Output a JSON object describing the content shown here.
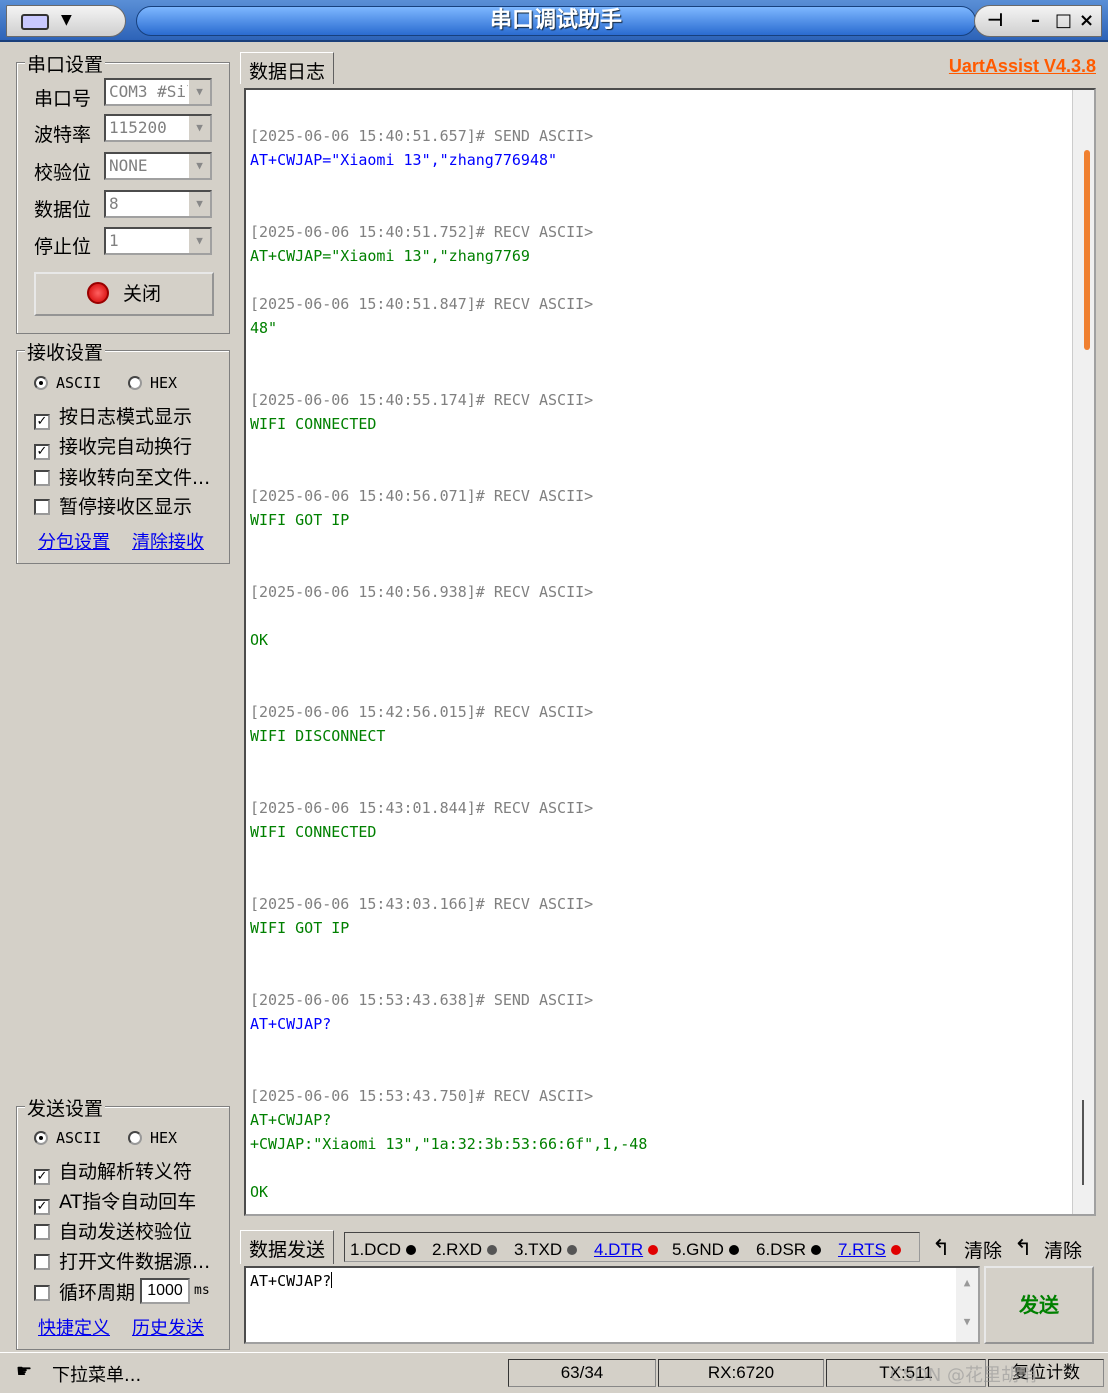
{
  "window": {
    "title": "串口调试助手",
    "brand": "UartAssist V4.3.8"
  },
  "serial": {
    "group_title": "串口设置",
    "port_label": "串口号",
    "port_value": "COM3 #Sil",
    "baud_label": "波特率",
    "baud_value": "115200",
    "parity_label": "校验位",
    "parity_value": "NONE",
    "databits_label": "数据位",
    "databits_value": "8",
    "stopbits_label": "停止位",
    "stopbits_value": "1",
    "close_button": "关闭"
  },
  "receive": {
    "group_title": "接收设置",
    "ascii": "ASCII",
    "hex": "HEX",
    "opt_log_mode": "按日志模式显示",
    "opt_auto_newline": "接收完自动换行",
    "opt_to_file": "接收转向至文件...",
    "opt_pause": "暂停接收区显示",
    "link_packet": "分包设置",
    "link_clear": "清除接收"
  },
  "send_settings": {
    "group_title": "发送设置",
    "ascii": "ASCII",
    "hex": "HEX",
    "opt_escape": "自动解析转义符",
    "opt_at_cr": "AT指令自动回车",
    "opt_checksum": "自动发送校验位",
    "opt_file_src": "打开文件数据源...",
    "opt_loop": "循环周期",
    "loop_value": "1000",
    "loop_unit": "ms",
    "link_shortcut": "快捷定义",
    "link_history": "历史发送"
  },
  "log": {
    "tab": "数据日志",
    "entries": [
      {
        "ts": "[2025-06-06 15:40:51.657]# SEND ASCII>",
        "lines": [
          "AT+CWJAP=\"Xiaomi 13\",\"zhang776948\""
        ],
        "kind": "send"
      },
      {
        "ts": "[2025-06-06 15:40:51.752]# RECV ASCII>",
        "lines": [
          "AT+CWJAP=\"Xiaomi 13\",\"zhang7769"
        ],
        "kind": "recv"
      },
      {
        "ts": "[2025-06-06 15:40:51.847]# RECV ASCII>",
        "lines": [
          "48\""
        ],
        "kind": "recv"
      },
      {
        "ts": "[2025-06-06 15:40:55.174]# RECV ASCII>",
        "lines": [
          "WIFI CONNECTED"
        ],
        "kind": "recv"
      },
      {
        "ts": "[2025-06-06 15:40:56.071]# RECV ASCII>",
        "lines": [
          "WIFI GOT IP"
        ],
        "kind": "recv"
      },
      {
        "ts": "[2025-06-06 15:40:56.938]# RECV ASCII>",
        "lines": [
          "",
          "OK"
        ],
        "kind": "recv"
      },
      {
        "ts": "[2025-06-06 15:42:56.015]# RECV ASCII>",
        "lines": [
          "WIFI DISCONNECT"
        ],
        "kind": "recv"
      },
      {
        "ts": "[2025-06-06 15:43:01.844]# RECV ASCII>",
        "lines": [
          "WIFI CONNECTED"
        ],
        "kind": "recv"
      },
      {
        "ts": "[2025-06-06 15:43:03.166]# RECV ASCII>",
        "lines": [
          "WIFI GOT IP"
        ],
        "kind": "recv"
      },
      {
        "ts": "[2025-06-06 15:53:43.638]# SEND ASCII>",
        "lines": [
          "AT+CWJAP?"
        ],
        "kind": "send"
      },
      {
        "ts": "[2025-06-06 15:53:43.750]# RECV ASCII>",
        "lines": [
          "AT+CWJAP?",
          "+CWJAP:\"Xiaomi 13\",\"1a:32:3b:53:66:6f\",1,-48",
          "",
          "OK"
        ],
        "kind": "recv"
      }
    ]
  },
  "send": {
    "tab": "数据发送",
    "signals": [
      {
        "label": "1.DCD",
        "led": "black",
        "link": false
      },
      {
        "label": "2.RXD",
        "led": "gray",
        "link": false
      },
      {
        "label": "3.TXD",
        "led": "gray",
        "link": false
      },
      {
        "label": "4.DTR",
        "led": "red",
        "link": true
      },
      {
        "label": "5.GND",
        "led": "black",
        "link": false
      },
      {
        "label": "6.DSR",
        "led": "black",
        "link": false
      },
      {
        "label": "7.RTS",
        "led": "red",
        "link": true
      }
    ],
    "clear1": "清除",
    "clear2": "清除",
    "input_value": "AT+CWJAP?",
    "send_button": "发送"
  },
  "status": {
    "menu": "下拉菜单...",
    "count": "63/34",
    "rx": "RX:6720",
    "tx": "TX:511",
    "reset": "复位计数",
    "watermark": "CSDN @花里胡哨"
  },
  "colors": {
    "send": "#0000ff",
    "recv": "#008000",
    "timestamp": "#808080",
    "brand": "#ff5a00",
    "led_red": "#e00000"
  }
}
